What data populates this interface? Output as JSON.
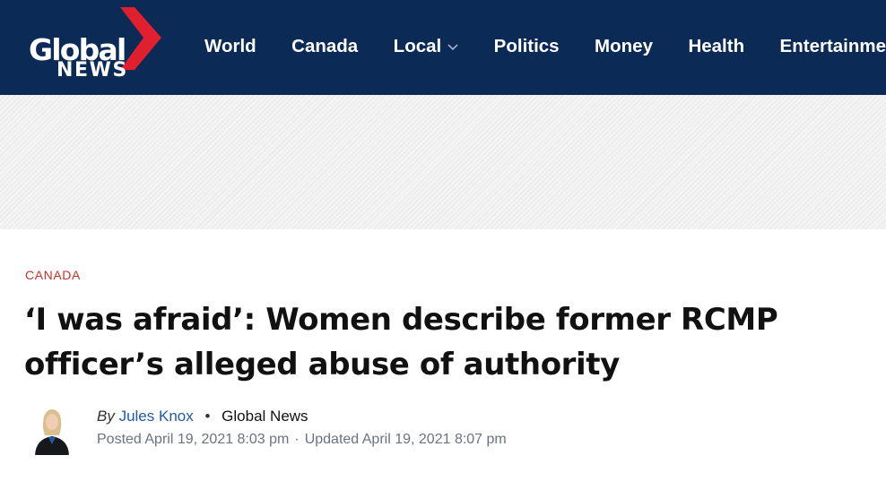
{
  "header": {
    "logo": {
      "top": "Global",
      "bottom": "NEWS"
    },
    "nav": [
      {
        "label": "World",
        "dropdown": false
      },
      {
        "label": "Canada",
        "dropdown": false
      },
      {
        "label": "Local",
        "dropdown": true
      },
      {
        "label": "Politics",
        "dropdown": false
      },
      {
        "label": "Money",
        "dropdown": false
      },
      {
        "label": "Health",
        "dropdown": false
      },
      {
        "label": "Entertainment",
        "dropdown": false
      }
    ]
  },
  "article": {
    "category": "CANADA",
    "headline": "‘I was afraid’: Women describe former RCMP officer’s alleged abuse of authority",
    "byline": {
      "by_label": "By",
      "author": "Jules Knox",
      "separator": "•",
      "source": "Global News",
      "posted": "Posted April 19, 2021 8:03 pm",
      "date_separator": "·",
      "updated": "Updated April 19, 2021 8:07 pm"
    }
  },
  "colors": {
    "header_bg": "#0b2a56",
    "logo_red": "#e0202e",
    "category_red": "#c4312b",
    "author_link": "#1f5ba8"
  }
}
